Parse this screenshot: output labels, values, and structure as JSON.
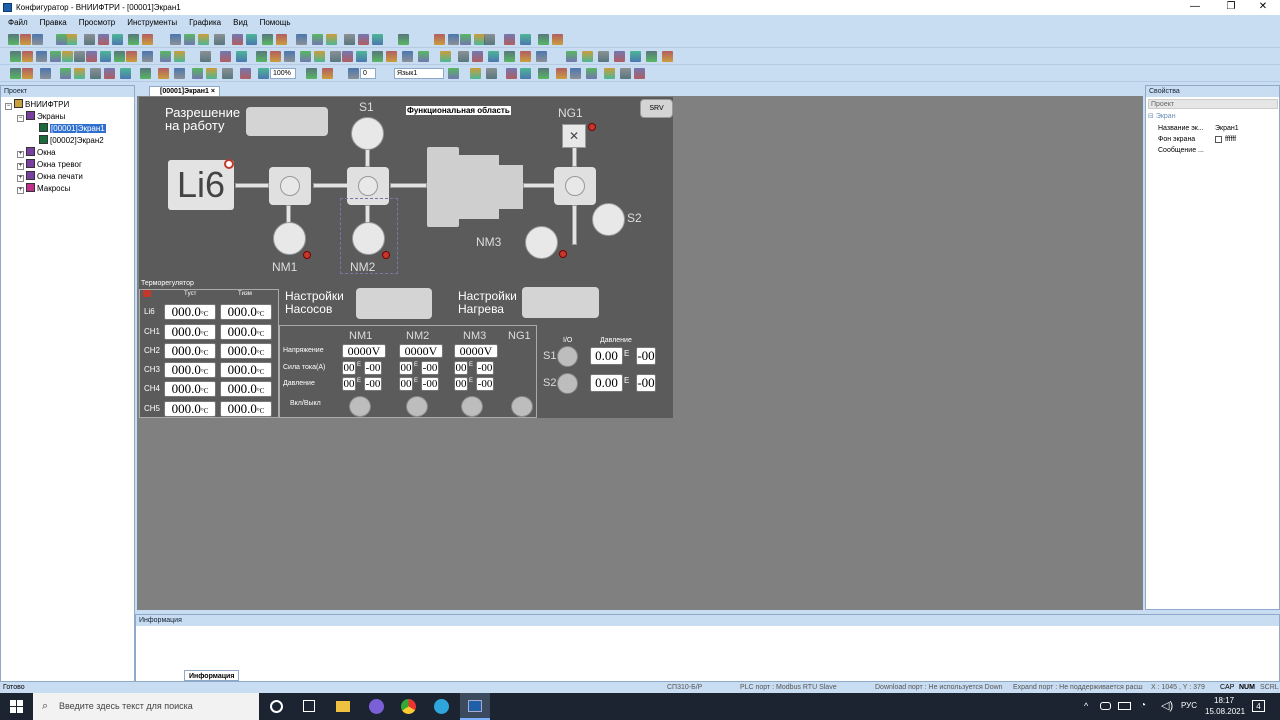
{
  "window": {
    "title": "Конфигуратор - ВНИИФТРИ - [00001]Экран1"
  },
  "menu": [
    "Файл",
    "Правка",
    "Просмотр",
    "Инструменты",
    "Графика",
    "Вид",
    "Помощь"
  ],
  "toolbar": {
    "zoom": "100%",
    "layer": "0",
    "language": "Язык1"
  },
  "project_pane": {
    "title": "Проект",
    "tree": [
      {
        "label": "ВНИИФТРИ",
        "level": 0
      },
      {
        "label": "Экраны",
        "level": 1
      },
      {
        "label": "[00001]Экран1",
        "level": 2,
        "selected": true
      },
      {
        "label": "[00002]Экран2",
        "level": 2
      },
      {
        "label": "Окна",
        "level": 1
      },
      {
        "label": "Окна тревог",
        "level": 1
      },
      {
        "label": "Окна печати",
        "level": 1
      },
      {
        "label": "Макросы",
        "level": 1
      }
    ]
  },
  "editor": {
    "tab": "[00001]Экран1",
    "tab_close": "×"
  },
  "hmi": {
    "permit_label": "Разрешение\nна работу",
    "area_label": "Функциональная область",
    "srv": "SRV",
    "li6": "Li6",
    "s1": "S1",
    "s2": "S2",
    "ng1": "NG1",
    "nm1": "NM1",
    "nm2": "NM2",
    "nm3": "NM3",
    "thermo": {
      "title": "Терморегулятор",
      "col_set": "Tуст",
      "col_meas": "Tизм",
      "unit": "°C",
      "rows": [
        {
          "name": "Li6",
          "set": "000.0",
          "meas": "000.0"
        },
        {
          "name": "CH1",
          "set": "000.0",
          "meas": "000.0"
        },
        {
          "name": "CH2",
          "set": "000.0",
          "meas": "000.0"
        },
        {
          "name": "CH3",
          "set": "000.0",
          "meas": "000.0"
        },
        {
          "name": "CH4",
          "set": "000.0",
          "meas": "000.0"
        },
        {
          "name": "CH5",
          "set": "000.0",
          "meas": "000.0"
        }
      ]
    },
    "pump_settings": "Настройки\nНасосов",
    "heat_settings": "Настройки\nНагрева",
    "pumps": {
      "cols": [
        "NM1",
        "NM2",
        "NM3",
        "NG1"
      ],
      "row_voltage": "Напряжение",
      "row_current": "Сила тока(A)",
      "row_pressure": "Давление",
      "row_onoff": "Вкл/Выкл",
      "voltage": "0000",
      "volt_unit": "V",
      "mant": "00",
      "exp": "-00",
      "e": "E"
    },
    "gauges": {
      "io": "I/O",
      "pressure": "Давление",
      "s1": "S1",
      "s2": "S2",
      "value": "0.00",
      "exp": "-00",
      "e": "E"
    }
  },
  "properties": {
    "title": "Свойства",
    "group_project": "Проект",
    "group_screen": "Экран",
    "rows": [
      {
        "key": "Название эк...",
        "val": "Экран1"
      },
      {
        "key": "Фон экрана",
        "val": "ffffff"
      },
      {
        "key": "Сообщение ...",
        "val": ""
      }
    ]
  },
  "info": {
    "title": "Информация",
    "tab": "Информация"
  },
  "status": {
    "ready": "Готово",
    "model": "СП310-Б/Р",
    "plc": "PLC порт : Modbus RTU Slave",
    "download": "Download порт : Не используется Down",
    "expand": "Expand порт : Не поддерживается расш",
    "coords": "X : 1045 , Y : 379",
    "caps": "CAP",
    "num": "NUM",
    "scrl": "SCRL"
  },
  "taskbar": {
    "search": "Введите здесь текст для поиска",
    "lang": "РУС",
    "time": "18:17",
    "date": "15.08.2021",
    "notif": "4"
  }
}
